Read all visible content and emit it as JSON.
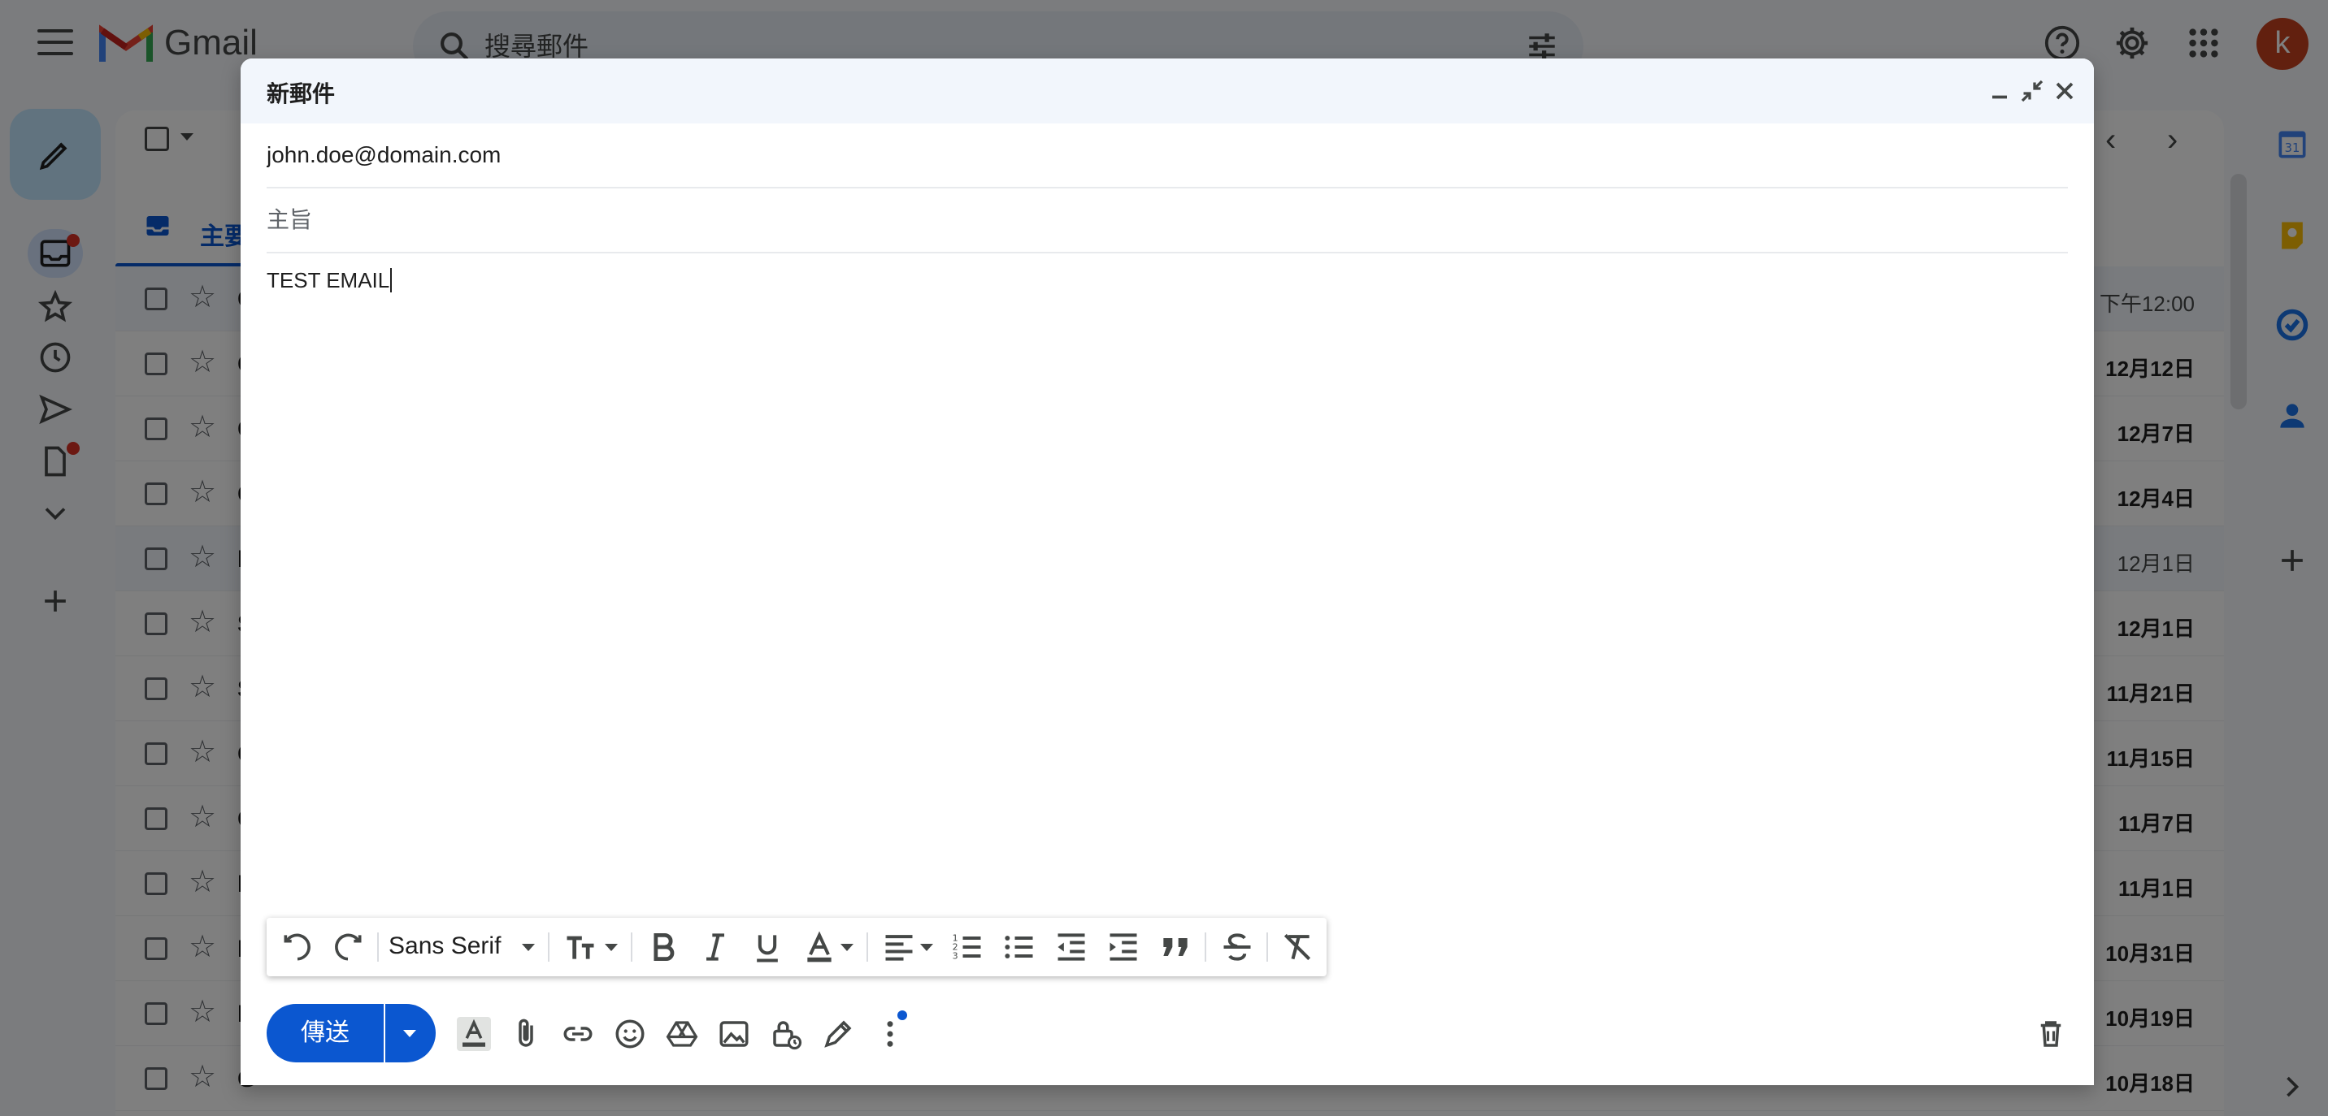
{
  "app": {
    "name": "Gmail",
    "account_initial": "k"
  },
  "search": {
    "placeholder": "搜尋郵件"
  },
  "tabs": {
    "primary_label": "主要"
  },
  "inbox_rows": [
    {
      "sender_initial": "C",
      "date": "下午12:00",
      "read": true
    },
    {
      "sender_initial": "C",
      "date": "12月12日",
      "read": false
    },
    {
      "sender_initial": "C",
      "date": "12月7日",
      "read": false
    },
    {
      "sender_initial": "C",
      "date": "12月4日",
      "read": false
    },
    {
      "sender_initial": "L",
      "date": "12月1日",
      "read": true
    },
    {
      "sender_initial": "S",
      "date": "12月1日",
      "read": false
    },
    {
      "sender_initial": "S",
      "date": "11月21日",
      "read": false
    },
    {
      "sender_initial": "C",
      "date": "11月15日",
      "read": false
    },
    {
      "sender_initial": "C",
      "date": "11月7日",
      "read": false
    },
    {
      "sender_initial": "I",
      "date": "11月1日",
      "read": false
    },
    {
      "sender_initial": "I",
      "date": "10月31日",
      "read": false
    },
    {
      "sender_initial": "I",
      "date": "10月19日",
      "read": false
    },
    {
      "sender_initial": "G",
      "date": "10月18日",
      "read": false
    }
  ],
  "compose": {
    "title": "新郵件",
    "to_value": "john.doe@domain.com",
    "subject_placeholder": "主旨",
    "body": "TEST EMAIL",
    "font_name": "Sans Serif",
    "send_label": "傳送"
  },
  "colors": {
    "accent": "#0b57d0",
    "avatar": "#c5401f",
    "notification_dot": "#d93025"
  }
}
